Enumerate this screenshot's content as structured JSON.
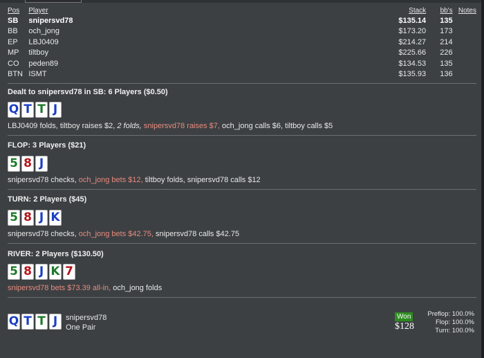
{
  "table": {
    "headers": {
      "pos": "Pos",
      "player": "Player",
      "stack": "Stack",
      "bb": "bb's",
      "notes": "Notes"
    },
    "rows": [
      {
        "pos": "SB",
        "player": "snipersvd78",
        "stack": "$135.14",
        "bb": "135",
        "hero": true
      },
      {
        "pos": "BB",
        "player": "och_jong",
        "stack": "$173.20",
        "bb": "173"
      },
      {
        "pos": "EP",
        "player": "LBJ0409",
        "stack": "$214.27",
        "bb": "214"
      },
      {
        "pos": "MP",
        "player": "tiltboy",
        "stack": "$225.66",
        "bb": "226"
      },
      {
        "pos": "CO",
        "player": "peden89",
        "stack": "$134.53",
        "bb": "135"
      },
      {
        "pos": "BTN",
        "player": "ISMT",
        "stack": "$135.93",
        "bb": "136"
      }
    ]
  },
  "preflop": {
    "title": "Dealt to snipersvd78 in SB: 6 Players ($0.50)",
    "cards": [
      {
        "rank": "Q",
        "suit": "d"
      },
      {
        "rank": "T",
        "suit": "d"
      },
      {
        "rank": "T",
        "suit": "c"
      },
      {
        "rank": "J",
        "suit": "d"
      }
    ],
    "actions": [
      {
        "text": "LBJ0409 folds, tiltboy raises $2, ",
        "style": "normal"
      },
      {
        "text": "2 folds, ",
        "style": "italic"
      },
      {
        "text": "snipersvd78 raises $7, ",
        "style": "red"
      },
      {
        "text": "och_jong calls $6, tiltboy calls $5",
        "style": "normal"
      }
    ]
  },
  "flop": {
    "title": "FLOP: 3 Players ($21)",
    "cards": [
      {
        "rank": "5",
        "suit": "c"
      },
      {
        "rank": "8",
        "suit": "h"
      },
      {
        "rank": "J",
        "suit": "d"
      }
    ],
    "actions": [
      {
        "text": "snipersvd78 checks, ",
        "style": "normal"
      },
      {
        "text": "och_jong bets $12, ",
        "style": "red"
      },
      {
        "text": "tiltboy folds, snipersvd78 calls $12",
        "style": "normal"
      }
    ]
  },
  "turn": {
    "title": "TURN: 2 Players ($45)",
    "cards": [
      {
        "rank": "5",
        "suit": "c"
      },
      {
        "rank": "8",
        "suit": "h"
      },
      {
        "rank": "J",
        "suit": "d"
      },
      {
        "rank": "K",
        "suit": "d"
      }
    ],
    "actions": [
      {
        "text": "snipersvd78 checks, ",
        "style": "normal"
      },
      {
        "text": "och_jong bets $42.75, ",
        "style": "red"
      },
      {
        "text": "snipersvd78 calls $42.75",
        "style": "normal"
      }
    ]
  },
  "river": {
    "title": "RIVER: 2 Players ($130.50)",
    "cards": [
      {
        "rank": "5",
        "suit": "c"
      },
      {
        "rank": "8",
        "suit": "h"
      },
      {
        "rank": "J",
        "suit": "d"
      },
      {
        "rank": "K",
        "suit": "c"
      },
      {
        "rank": "7",
        "suit": "h"
      }
    ],
    "actions": [
      {
        "text": "snipersvd78 bets $73.39 all-in, ",
        "style": "red"
      },
      {
        "text": "och_jong folds",
        "style": "normal"
      }
    ]
  },
  "summary": {
    "cards": [
      {
        "rank": "Q",
        "suit": "d"
      },
      {
        "rank": "T",
        "suit": "d"
      },
      {
        "rank": "T",
        "suit": "c"
      },
      {
        "rank": "J",
        "suit": "d"
      }
    ],
    "player": "snipersvd78",
    "hand": "One Pair",
    "won_label": "Won",
    "won_amount": "$128",
    "equity": [
      {
        "label": "Preflop:",
        "value": "100.0%"
      },
      {
        "label": "Flop:",
        "value": "100.0%"
      },
      {
        "label": "Turn:",
        "value": "100.0%"
      }
    ]
  },
  "colors": {
    "background": "#3c4043",
    "hero_action": "#e88a7e",
    "won_badge": "#2e8b1f",
    "suit_clubs": "#1f7a2a",
    "suit_diamonds": "#1b3fc4",
    "suit_hearts": "#b2151c"
  }
}
